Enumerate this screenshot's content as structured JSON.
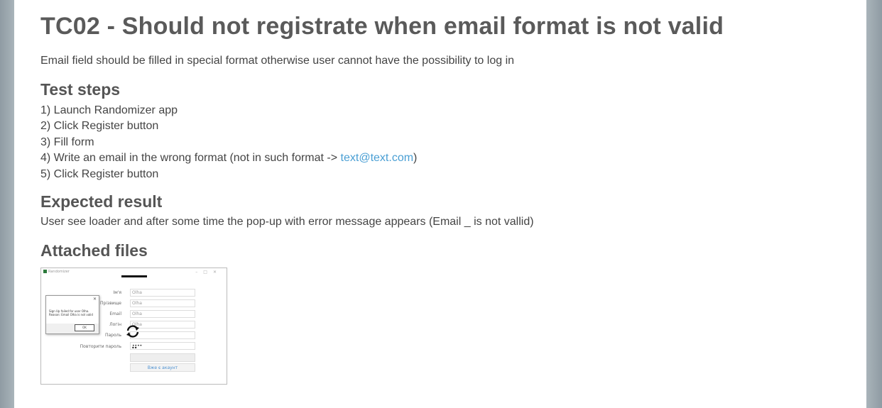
{
  "test_case": {
    "title": "TC02 - Should not registrate when email format is not valid",
    "description": "Email field should be filled in special format otherwise user cannot have the possibility to log in"
  },
  "sections": {
    "steps_heading": "Test steps",
    "steps": [
      "1) Launch Randomizer app",
      "2) Click Register button",
      "3) Fill form"
    ],
    "step4_prefix": "4) Write an email in the wrong format (not in such format -> ",
    "step4_link": "text@text.com",
    "step4_suffix": ")",
    "step5": "5) Click Register button",
    "expected_heading": "Expected result",
    "expected_text": "User see loader and after some time the pop-up with error message appears (Email _ is not vallid)",
    "attached_heading": "Attached files"
  },
  "attachment": {
    "window_title": "Randomizer",
    "window_controls": "–□✕",
    "fields": [
      {
        "label": "Ім'я",
        "value": "Olha"
      },
      {
        "label": "Прізвище",
        "value": "Olha"
      },
      {
        "label": "Email",
        "value": "Olha"
      },
      {
        "label": "Логін",
        "value": "Olha"
      },
      {
        "label": "Пароль",
        "value": ""
      },
      {
        "label": "Повторити пароль",
        "value": "••••"
      }
    ],
    "login_link": "Вже є акаунт",
    "dialog_close": "✕",
    "dialog_message": "Sign Up failed for user Olha. Reason: Email Olha is not valid",
    "dialog_ok": "OK",
    "password_dots": "••"
  },
  "colors": {
    "link": "#4a9fd4",
    "heading": "#555555",
    "text": "#444444"
  }
}
